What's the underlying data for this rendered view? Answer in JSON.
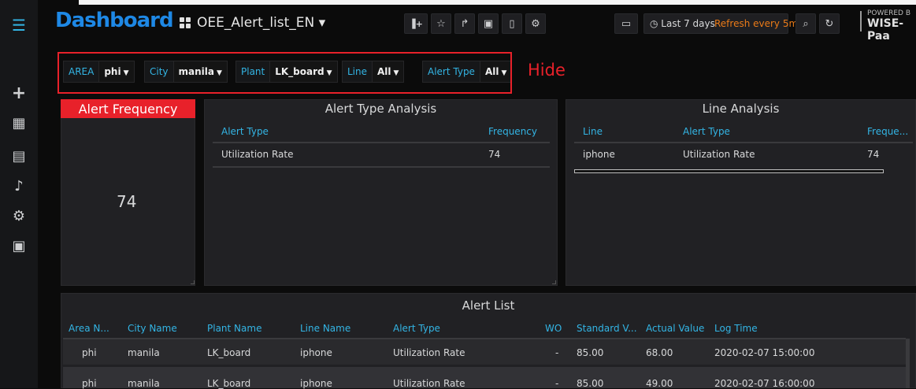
{
  "sidebar": {
    "items": [
      {
        "icon": "menu-icon",
        "glyph": "☰"
      },
      {
        "icon": "plus-icon",
        "glyph": "+"
      },
      {
        "icon": "dashboards-icon",
        "glyph": "▦"
      },
      {
        "icon": "playlist-icon",
        "glyph": "▤"
      },
      {
        "icon": "bell-icon",
        "glyph": "♪"
      },
      {
        "icon": "gear-icon",
        "glyph": "⚙"
      },
      {
        "icon": "book-icon",
        "glyph": "▣"
      }
    ]
  },
  "header": {
    "brand": "Dashboard",
    "dashboard_title": "OEE_Alert_list_EN ▾",
    "time_range": "◷ Last 7 days",
    "refresh": "Refresh every 5m",
    "powered_by": "POWERED B",
    "wise": "WISE-Paa",
    "buttons": [
      {
        "name": "add-panel-button",
        "glyph": "▐+"
      },
      {
        "name": "star-button",
        "glyph": "☆"
      },
      {
        "name": "share-button",
        "glyph": "↱"
      },
      {
        "name": "save-button",
        "glyph": "▣"
      },
      {
        "name": "mobile-button",
        "glyph": "▯"
      },
      {
        "name": "settings-button",
        "glyph": "⚙"
      },
      {
        "name": "tv-mode-button",
        "glyph": "▭"
      },
      {
        "name": "zoom-out-button",
        "glyph": "⌕"
      },
      {
        "name": "refresh-button",
        "glyph": "↻"
      }
    ]
  },
  "variables": [
    {
      "label": "AREA",
      "value": "phi"
    },
    {
      "label": "City",
      "value": "manila"
    },
    {
      "label": "Plant",
      "value": "LK_board"
    },
    {
      "label": "Line",
      "value": "All"
    },
    {
      "label": "Alert Type",
      "value": "All"
    }
  ],
  "annotation": "Hide",
  "alert_frequency": {
    "title": "Alert Frequency",
    "value": "74"
  },
  "alert_type_analysis": {
    "title": "Alert Type Analysis",
    "headers": [
      "Alert Type",
      "Frequency"
    ],
    "rows": [
      [
        "Utilization Rate",
        "74"
      ]
    ]
  },
  "line_analysis": {
    "title": "Line Analysis",
    "headers": [
      "Line",
      "Alert Type",
      "Freque..."
    ],
    "rows": [
      [
        "iphone",
        "Utilization Rate",
        "74"
      ]
    ]
  },
  "alert_list": {
    "title": "Alert List",
    "headers": [
      "Area N...",
      "City Name",
      "Plant Name",
      "Line Name",
      "Alert Type",
      "WO",
      "Standard V...",
      "Actual Value",
      "Log Time"
    ],
    "rows": [
      [
        "phi",
        "manila",
        "LK_board",
        "iphone",
        "Utilization Rate",
        "-",
        "85.00",
        "68.00",
        "2020-02-07 15:00:00"
      ],
      [
        "phi",
        "manila",
        "LK_board",
        "iphone",
        "Utilization Rate",
        "-",
        "85.00",
        "49.00",
        "2020-02-07 16:00:00"
      ]
    ]
  }
}
